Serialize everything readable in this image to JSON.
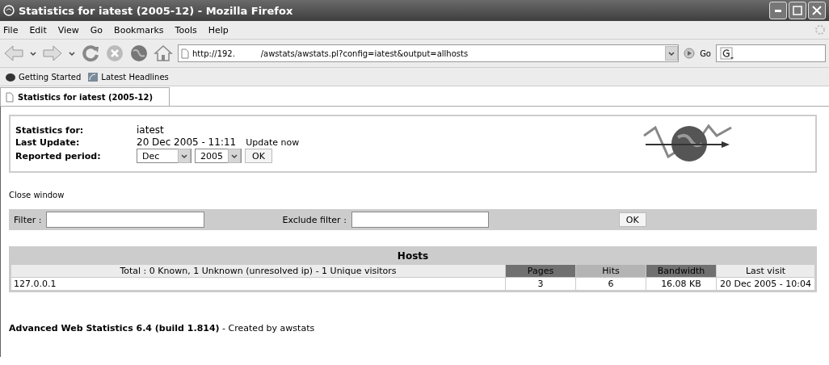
{
  "window": {
    "title": "Statistics for iatest (2005-12) - Mozilla Firefox"
  },
  "menu": [
    "File",
    "Edit",
    "View",
    "Go",
    "Bookmarks",
    "Tools",
    "Help"
  ],
  "address": {
    "value": "http://192.          /awstats/awstats.pl?config=iatest&output=allhosts",
    "go": "Go"
  },
  "bookmarks": [
    "Getting Started",
    "Latest Headlines"
  ],
  "tabs": [
    {
      "label": "Statistics for iatest (2005-12)",
      "selected": true
    }
  ],
  "info": {
    "rows": [
      {
        "label": "Statistics for:",
        "value": "iatest"
      },
      {
        "label": "Last Update:",
        "value": "20 Dec 2005 - 11:11",
        "link": "Update now"
      },
      {
        "label": "Reported period:",
        "month": "Dec",
        "year": "2005",
        "button": "OK"
      }
    ]
  },
  "close_link": "Close window",
  "filter": {
    "label": "Filter :",
    "exclude_label": "Exclude filter :",
    "button": "OK"
  },
  "hosts": {
    "title": "Hosts",
    "summary": "Total : 0 Known, 1 Unknown (unresolved ip) - 1 Unique visitors",
    "columns": [
      {
        "label": "Pages",
        "color": "#707070"
      },
      {
        "label": "Hits",
        "color": "#b4b4b4"
      },
      {
        "label": "Bandwidth",
        "color": "#707070"
      },
      {
        "label": "Last visit",
        "color": "#ececec"
      }
    ],
    "rows": [
      {
        "host": "127.0.0.1",
        "cells": [
          "3",
          "6",
          "16.08 KB",
          "20 Dec 2005 - 10:04"
        ]
      }
    ]
  },
  "footer": "**Advanced Web Statistics 6.4 (build 1.814)** - Created by awstats"
}
